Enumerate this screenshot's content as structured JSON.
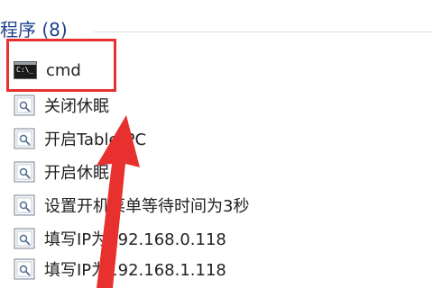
{
  "group": {
    "header": "程序 (8)"
  },
  "results": [
    {
      "label": "cmd",
      "icon": "cmd-icon"
    },
    {
      "label": "关闭休眠",
      "icon": "script-icon"
    },
    {
      "label": "开启TabletPC",
      "icon": "script-icon"
    },
    {
      "label": "开启休眠",
      "icon": "script-icon"
    },
    {
      "label": "设置开机菜单等待时间为3秒",
      "icon": "script-icon"
    },
    {
      "label": "填写IP为192.168.0.118",
      "icon": "script-icon"
    },
    {
      "label": "填写IP为192.168.1.118",
      "icon": "script-icon"
    }
  ],
  "colors": {
    "header": "#1e3f91",
    "highlight": "#e8302e",
    "arrow": "#e8302e"
  }
}
